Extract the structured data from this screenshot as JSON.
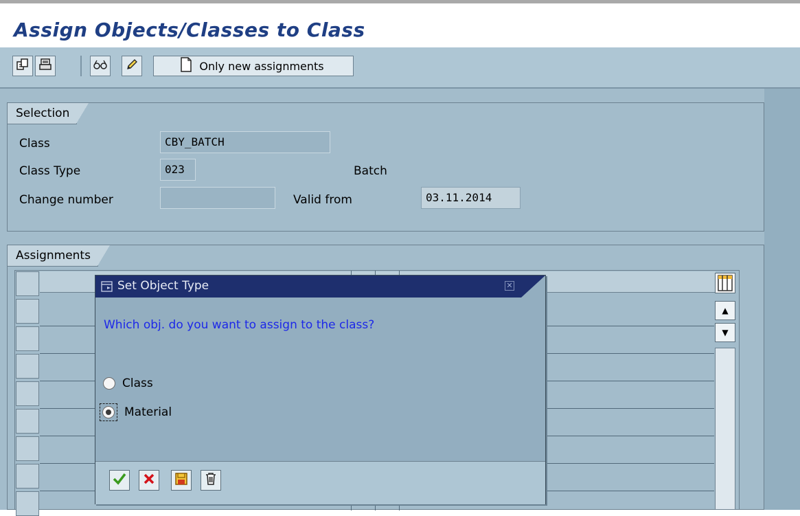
{
  "title": "Assign Objects/Classes to Class",
  "toolbar": {
    "only_new_assignments_label": "Only new assignments",
    "icons": [
      "copy-icon",
      "print-icon",
      "glasses-icon",
      "pencil-icon",
      "new-document-icon"
    ]
  },
  "selection": {
    "group_title": "Selection",
    "class_label": "Class",
    "class_value": "CBY_BATCH",
    "class_type_label": "Class Type",
    "class_type_value": "023",
    "class_type_desc": "Batch",
    "change_number_label": "Change number",
    "change_number_value": "",
    "valid_from_label": "Valid from",
    "valid_from_value": "03.11.2014"
  },
  "assignments": {
    "group_title": "Assignments"
  },
  "dialog": {
    "title": "Set Object Type",
    "question": "Which obj. do you want to assign to the class?",
    "options": [
      {
        "label": "Class",
        "selected": false
      },
      {
        "label": "Material",
        "selected": true
      }
    ],
    "footer_icons": [
      "checkmark-icon",
      "cancel-icon",
      "save-icon",
      "delete-icon"
    ]
  },
  "colors": {
    "title": "#1f3f84",
    "dialog_title_bg": "#1e2f6e",
    "question_text": "#1d28e8",
    "background": "#a3bccb"
  }
}
